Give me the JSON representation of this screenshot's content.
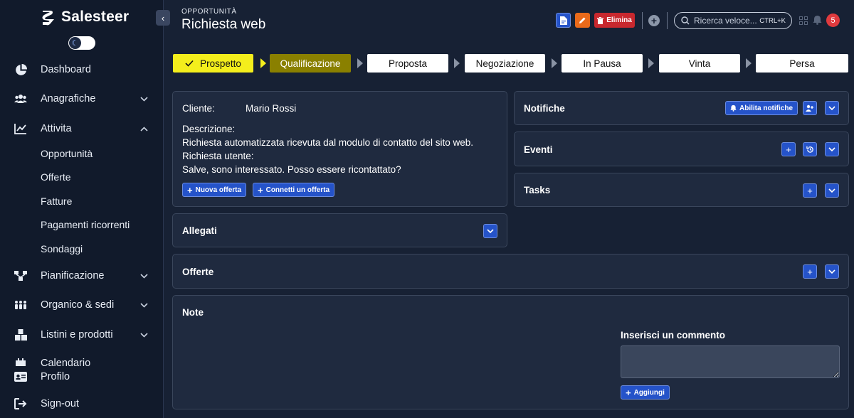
{
  "brand": {
    "name": "Salesteer"
  },
  "sidebar": {
    "items": [
      {
        "label": "Dashboard",
        "icon": "pie-chart-icon"
      },
      {
        "label": "Anagrafiche",
        "icon": "users-icon"
      },
      {
        "label": "Attivita",
        "icon": "chart-line-icon"
      },
      {
        "label": "Pianificazione",
        "icon": "flow-icon"
      },
      {
        "label": "Organico & sedi",
        "icon": "people-group-icon"
      },
      {
        "label": "Listini e prodotti",
        "icon": "boxes-icon"
      },
      {
        "label": "Calendario",
        "icon": "calendar-icon"
      }
    ],
    "subitems": [
      "Opportunità",
      "Offerte",
      "Fatture",
      "Pagamenti ricorrenti",
      "Sondaggi"
    ],
    "bottom": [
      {
        "label": "Profilo",
        "icon": "id-card-icon"
      },
      {
        "label": "Sign-out",
        "icon": "sign-out-icon"
      }
    ]
  },
  "header": {
    "subtitle": "OPPORTUNITÀ",
    "title": "Richiesta web",
    "delete_label": "Elimina",
    "search_placeholder": "Ricerca veloce...",
    "search_shortcut": "CTRL+K",
    "notifications_count": "5"
  },
  "pipeline": {
    "stages": [
      "Prospetto",
      "Qualificazione",
      "Proposta",
      "Negoziazione",
      "In Pausa",
      "Vinta",
      "Persa"
    ],
    "current": "Qualificazione"
  },
  "details": {
    "client_label": "Cliente:",
    "client_value": "Mario Rossi",
    "description_label": "Descrizione:",
    "description_line1": "Richiesta automatizzata ricevuta dal modulo di contatto del sito web.",
    "description_line2": "Richiesta utente:",
    "description_line3": "Salve, sono interessato. Posso essere ricontattato?",
    "new_offer_label": "Nuova offerta",
    "connect_offer_label": "Connetti un offerta"
  },
  "panels": {
    "attachments": "Allegati",
    "notifications": "Notifiche",
    "enable_notifications": "Abilita notifiche",
    "events": "Eventi",
    "tasks": "Tasks",
    "offers": "Offerte",
    "notes": "Note",
    "comment_label": "Inserisci un commento",
    "add_label": "Aggiungi"
  },
  "colors": {
    "accent": "#2553c9",
    "stage_done": "#f4ee1c",
    "stage_current": "#8a8000",
    "danger": "#c8282e",
    "edit": "#ea6a1a"
  }
}
